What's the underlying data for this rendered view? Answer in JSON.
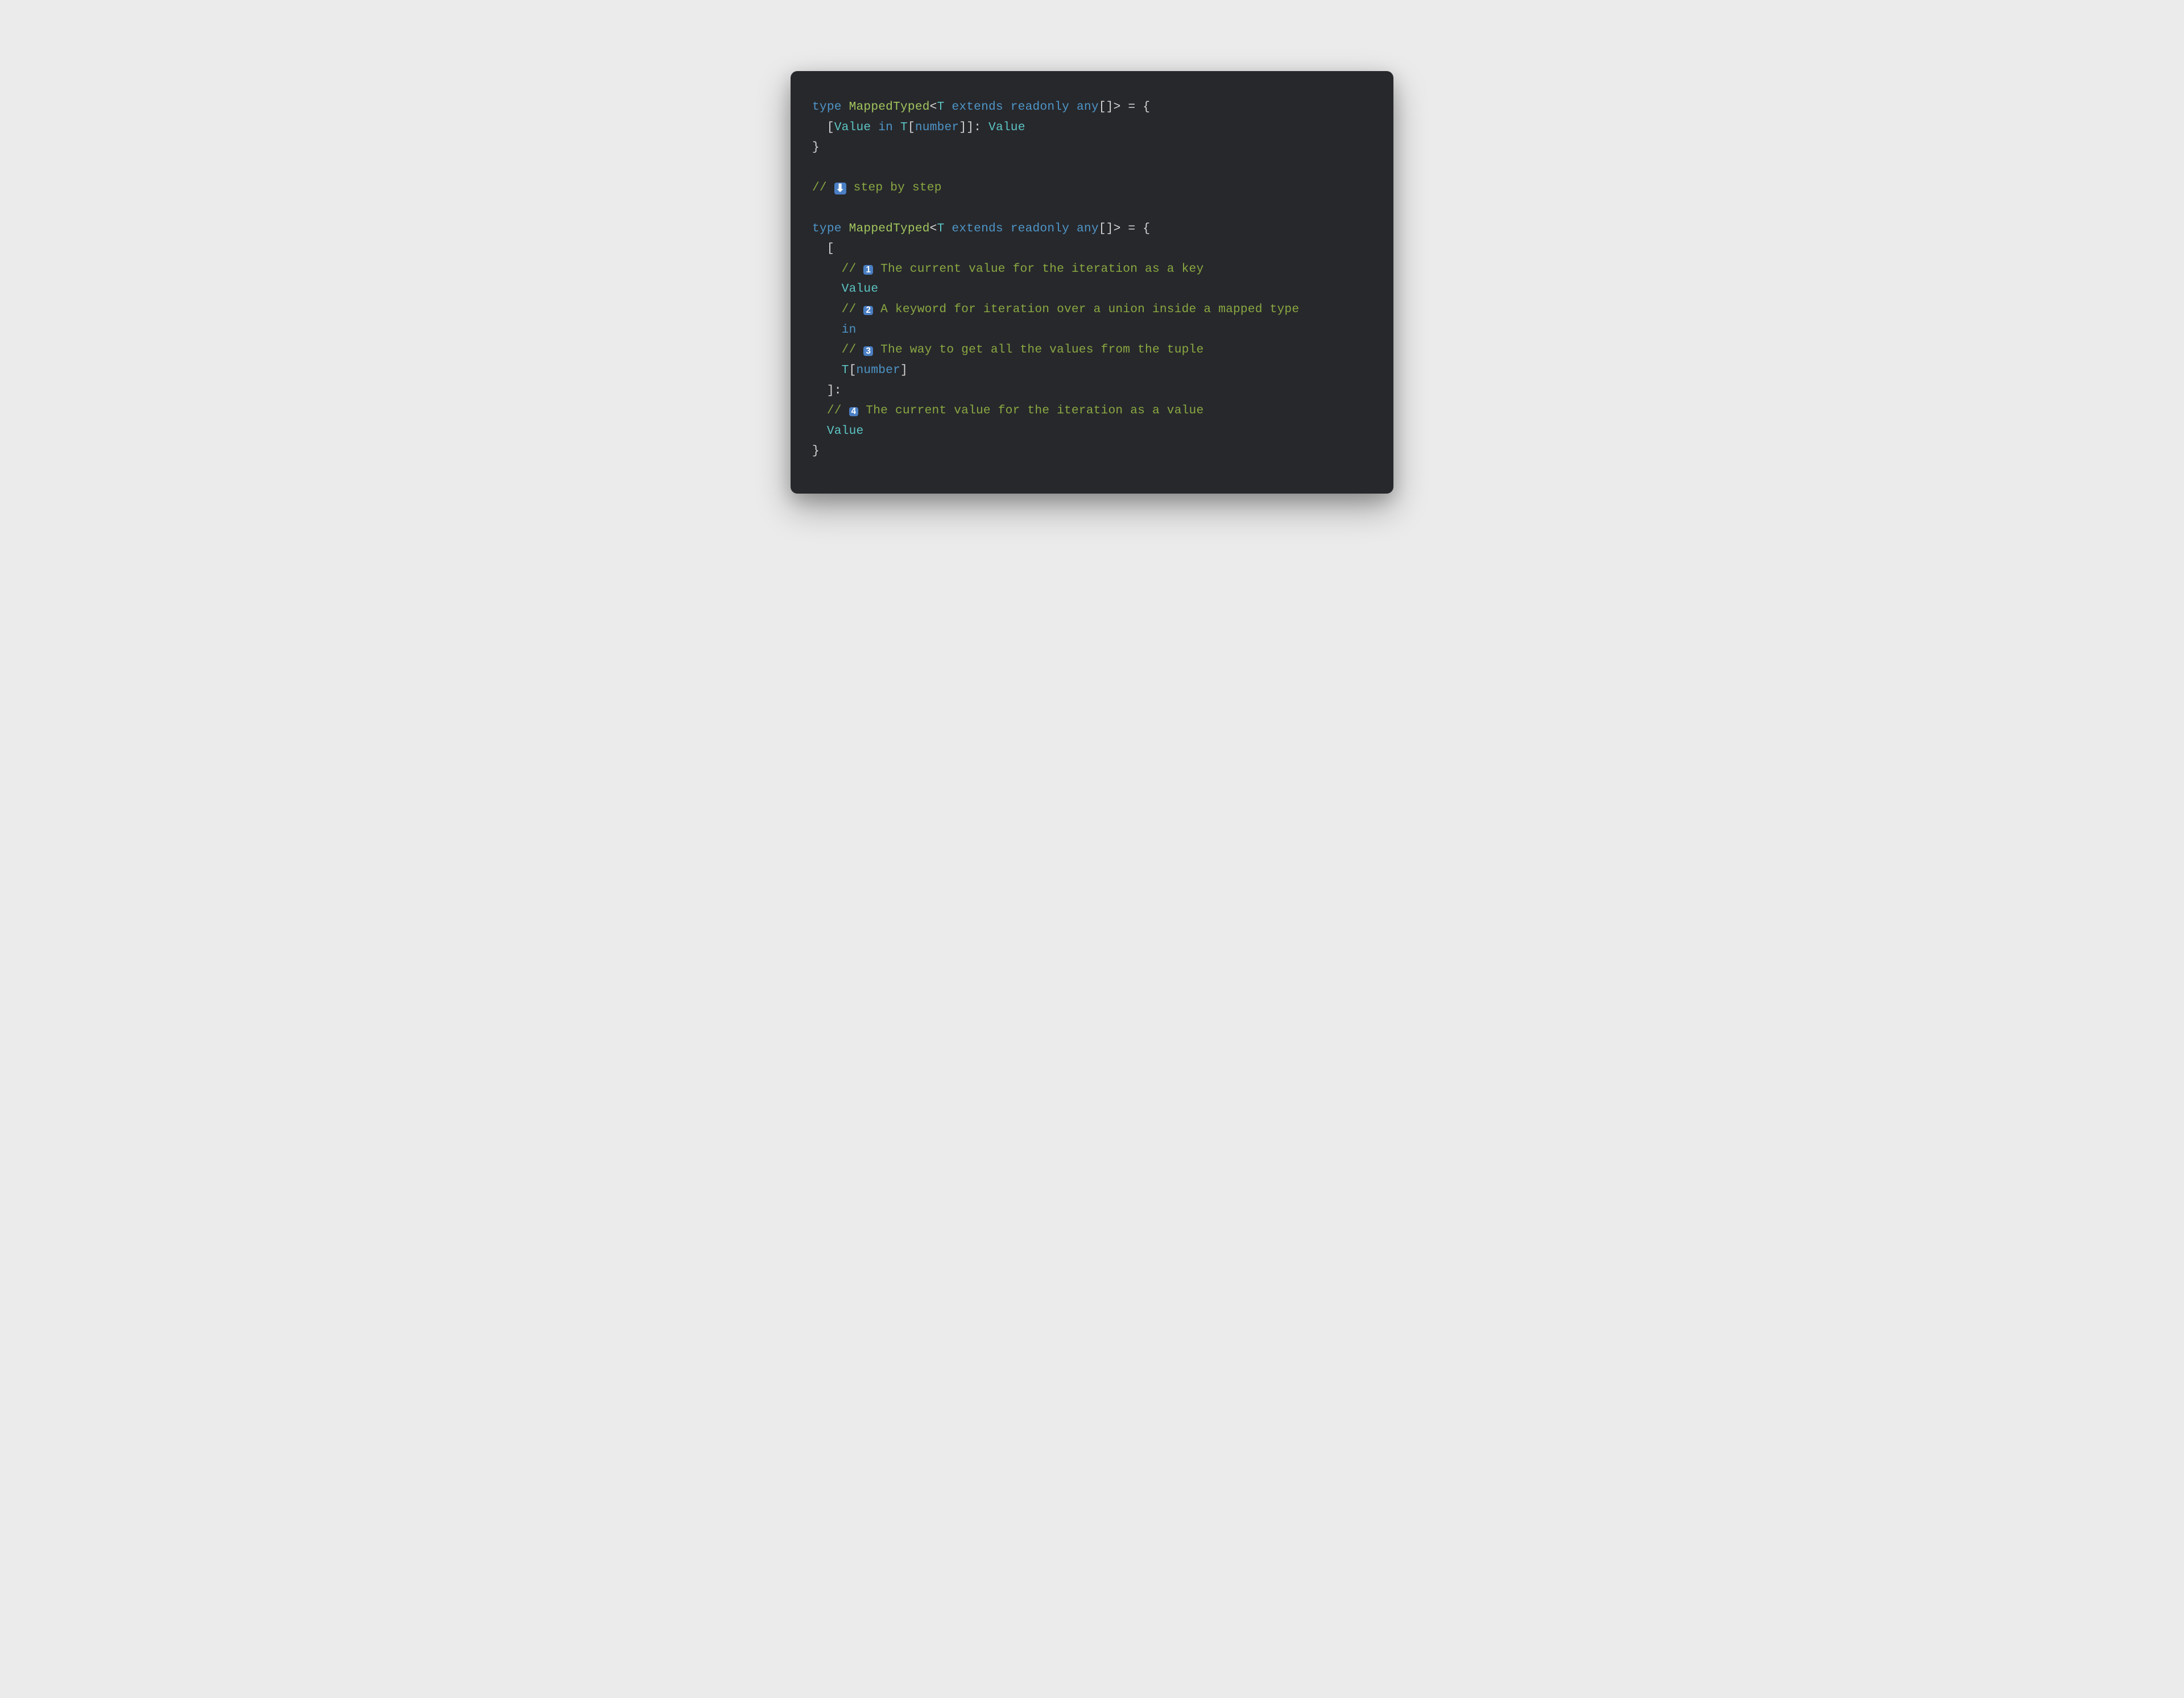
{
  "code": {
    "line1": {
      "kw_type": "type",
      "type_name": "MappedTyped",
      "lt": "<",
      "generic_t": "T",
      "kw_extends": "extends",
      "kw_readonly": "readonly",
      "kw_any": "any",
      "brackets": "[]",
      "gt": ">",
      "eq_brace": " = {"
    },
    "line2": {
      "indent_bracket": "  [",
      "value": "Value",
      "kw_in": "in",
      "t": "T",
      "open_br": "[",
      "kw_number": "number",
      "close_br_br": "]]",
      "colon": ": ",
      "value2": "Value"
    },
    "line3": {
      "close_brace": "}"
    },
    "comment_step": {
      "slashes": "// ",
      "arrow_emoji": "⬇",
      "text": " step by step"
    },
    "line5": {
      "kw_type": "type",
      "type_name": "MappedTyped",
      "lt": "<",
      "generic_t": "T",
      "kw_extends": "extends",
      "kw_readonly": "readonly",
      "kw_any": "any",
      "brackets": "[]",
      "gt": ">",
      "eq_brace": " = {"
    },
    "line6": {
      "indent_bracket": "  ["
    },
    "comment1": {
      "indent": "    ",
      "slashes": "// ",
      "num": "1",
      "text": " The current value for the iteration as a key"
    },
    "line_value": {
      "indent": "    ",
      "value": "Value"
    },
    "comment2": {
      "indent": "    ",
      "slashes": "// ",
      "num": "2",
      "text": " A keyword for iteration over a union inside a mapped type"
    },
    "line_in": {
      "indent": "    ",
      "kw_in": "in"
    },
    "comment3": {
      "indent": "    ",
      "slashes": "// ",
      "num": "3",
      "text": " The way to get all the values from the tuple"
    },
    "line_tnumber": {
      "indent": "    ",
      "t": "T",
      "open_br": "[",
      "kw_number": "number",
      "close_br": "]"
    },
    "line_close_key": {
      "indent": "  ",
      "close_br_colon": "]:"
    },
    "comment4": {
      "indent": "  ",
      "slashes": "// ",
      "num": "4",
      "text": " The current value for the iteration as a value"
    },
    "line_value2": {
      "indent": "  ",
      "value": "Value"
    },
    "line_close": {
      "close_brace": "}"
    }
  }
}
